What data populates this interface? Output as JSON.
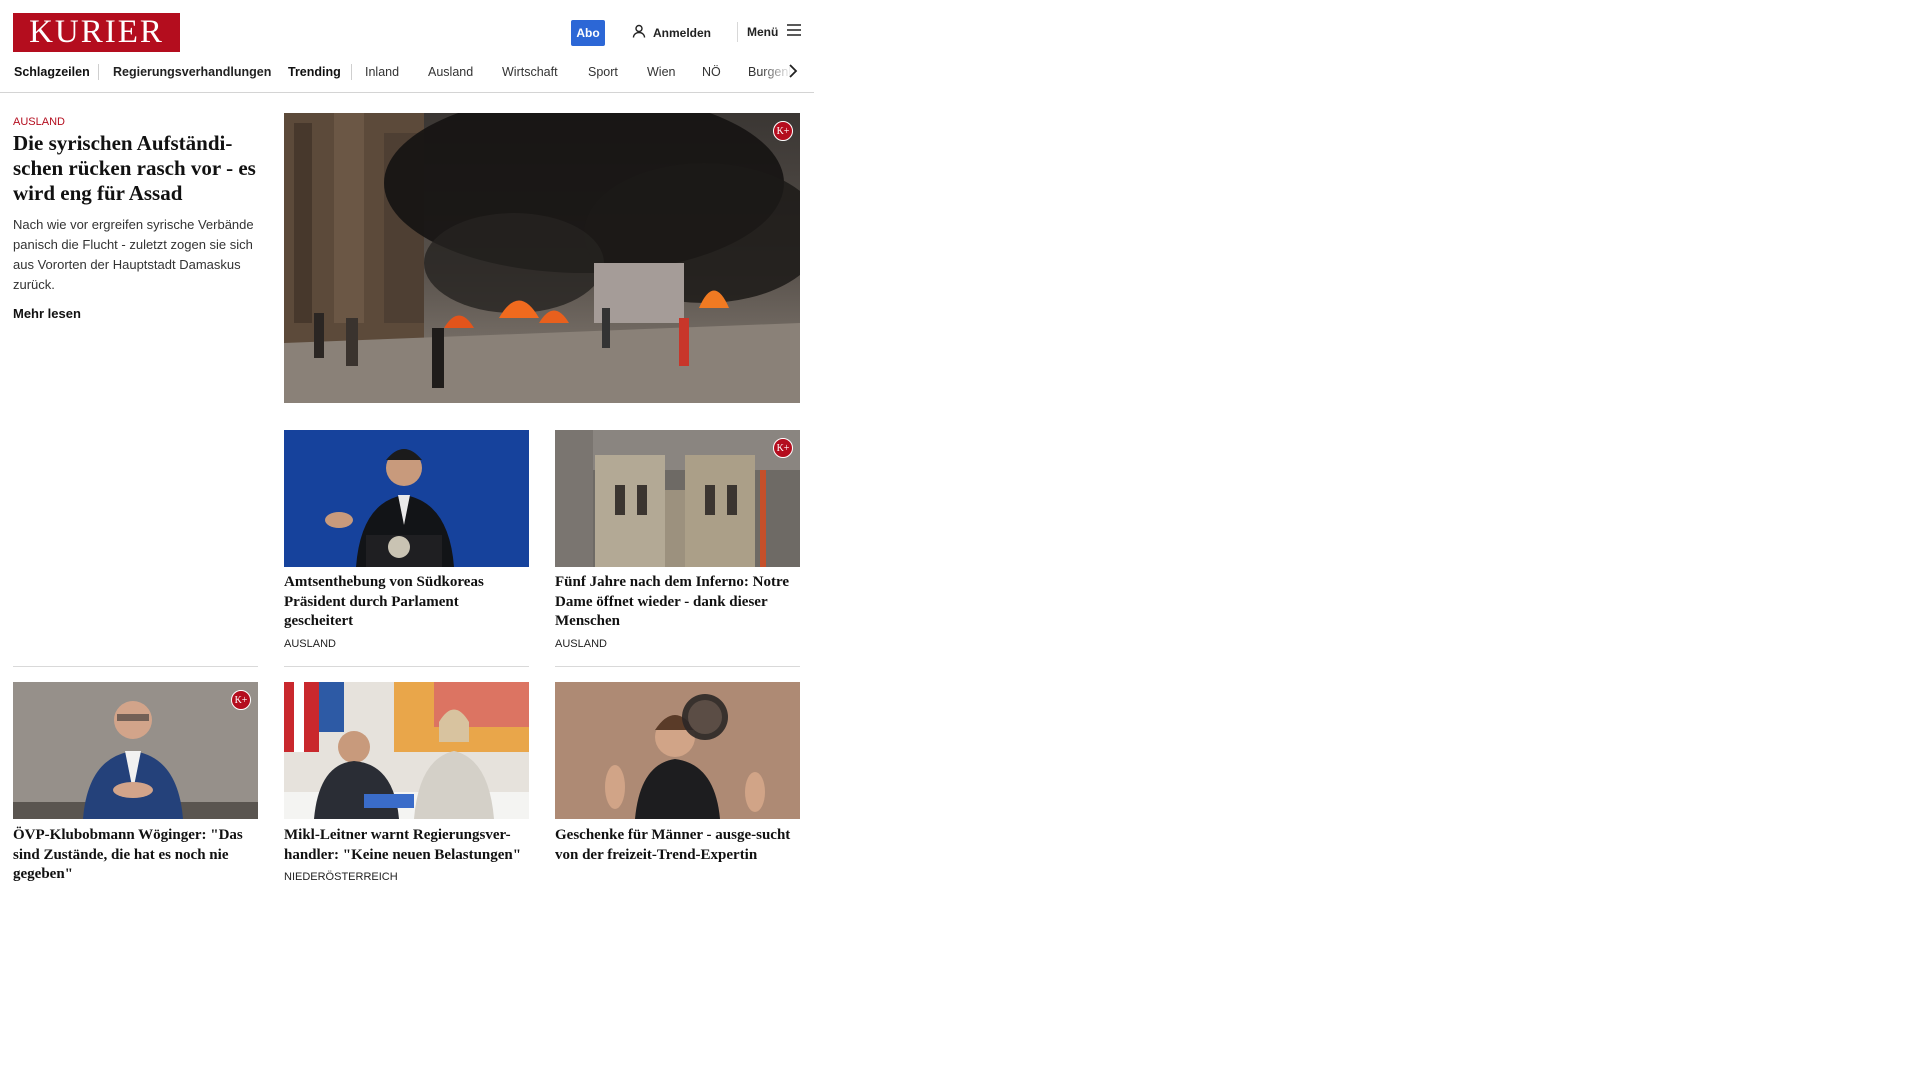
{
  "header": {
    "logo_text": "KURIER",
    "abo_label": "Abo",
    "login_label": "Anmelden",
    "menu_label": "Menü"
  },
  "nav": {
    "items": [
      "Schlagzeilen",
      "Regierungsverhandlungen",
      "Trending",
      "Inland",
      "Ausland",
      "Wirtschaft",
      "Sport",
      "Wien",
      "NÖ",
      "Burgenland"
    ]
  },
  "lead": {
    "category": "AUSLAND",
    "title": "Die syrischen Aufständi-schen rücken rasch vor - es wird eng für Assad",
    "teaser": "Nach wie vor ergreifen syrische Verbände panisch die Flucht - zuletzt zogen sie sich aus Vororten der Hauptstadt Damaskus zurück.",
    "more_label": "Mehr lesen",
    "plus_badge": "K+"
  },
  "cards": [
    {
      "title": "Amtsenthebung von Südkoreas Präsident durch Parlament gescheitert",
      "category": "AUSLAND"
    },
    {
      "title": "Fünf Jahre nach dem Inferno: Notre Dame öffnet wieder - dank dieser Menschen",
      "category": "AUSLAND",
      "plus_badge": "K+"
    },
    {
      "title": "ÖVP-Klubobmann Wöginger: \"Das sind Zustände, die hat es noch nie gegeben\"",
      "category": "",
      "plus_badge": "K+"
    },
    {
      "title": "Mikl-Leitner warnt Regierungsver-handler: \"Keine neuen Belastungen\"",
      "category": "NIEDERÖSTERREICH"
    },
    {
      "title": "Geschenke für Männer - ausge-sucht von der freizeit-Trend-Expertin",
      "category": ""
    }
  ],
  "colors": {
    "brand_red": "#b40d1e",
    "abo_blue": "#2c67d6"
  }
}
